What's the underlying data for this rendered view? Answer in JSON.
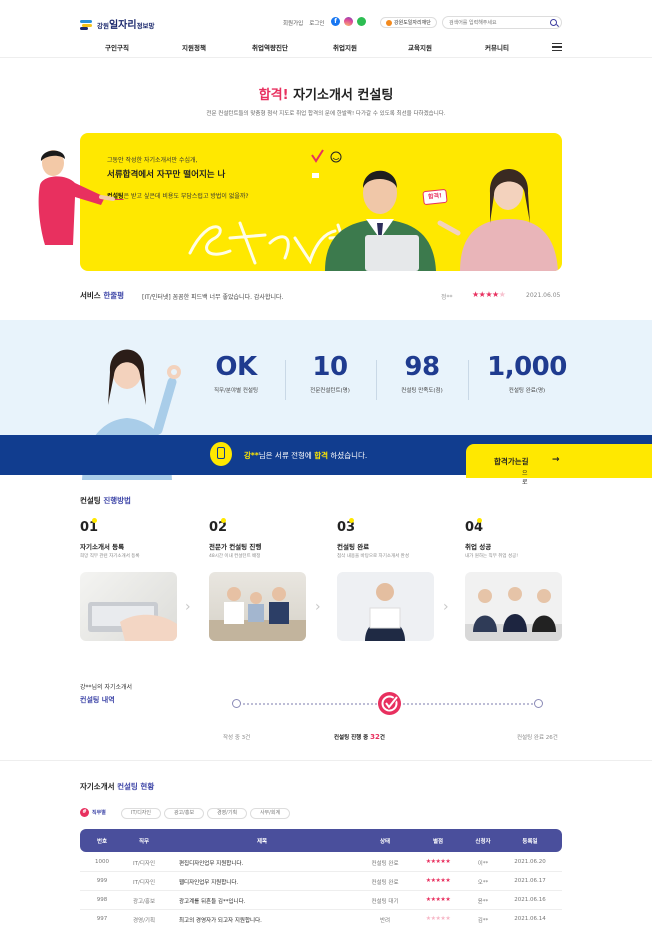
{
  "header": {
    "logo_prefix": "강원",
    "logo_main": "일자리",
    "logo_suffix": "정보망",
    "links": [
      "회원가입",
      "로그인"
    ],
    "gov_chip": "강원도일자리재단",
    "search_placeholder": "검색어를 입력해주세요"
  },
  "nav": [
    "구인구직",
    "지원정책",
    "취업역량진단",
    "취업지원",
    "교육지원",
    "커뮤니티"
  ],
  "hero": {
    "title_em": "합격!",
    "title_rest": " 자기소개서 컨설팅",
    "subtitle": "전문 컨설턴트들의 맞춤형 첨삭 지도로 취업 합격의 문에 한발짝! 다가갈 수 있도록 최선을 다하겠습니다."
  },
  "banner": {
    "line1": "그동안 작성한 자기소개서만 수십개,",
    "line2": "서류합격에서 자꾸만 떨어지는 나",
    "line3_em": "컨설팅",
    "line3_rest": "은 받고 싶은데 비용도 부담스럽고 방법이 없을까?",
    "script_word": "Start",
    "pass_tag": "합격!"
  },
  "review": {
    "label_a": "서비스 ",
    "label_b": "한줄평",
    "text": "[IT/인터넷] 꼼꼼한 피드백 너무 좋았습니다. 감사합니다.",
    "name": "정**",
    "rating": 4,
    "rating_max": 5,
    "stars_on": "★★★★",
    "stars_off": "★",
    "date": "2021.06.05"
  },
  "stats": [
    {
      "num": "OK",
      "label": "직무/분야별 컨설팅"
    },
    {
      "num": "10",
      "label": "전문컨설턴트(명)"
    },
    {
      "num": "98",
      "label": "컨설팅 만족도(점)"
    },
    {
      "num": "1,000",
      "label": "컨설팅 완료(명)"
    }
  ],
  "pass_band": {
    "name": "강**",
    "mid": "님은 서류 전형에 ",
    "em": "합격",
    "end": " 하셨습니다.",
    "button": "합격으로 가는길",
    "button_em": "합격",
    "button_rest": "으로 ",
    "button_end": "가는길",
    "arrow": "→"
  },
  "process": {
    "title_a": "컨설팅 ",
    "title_b": "진행방법",
    "steps": [
      {
        "n": "01",
        "title": "자기소개서 등록",
        "desc": "희망 직무 관련 자기소개서 등록"
      },
      {
        "n": "02",
        "title": "전문가 컨설팅 진행",
        "desc": "48시간 이내 컨설턴트 배정"
      },
      {
        "n": "03",
        "title": "컨설팅 완료",
        "desc": "첨삭 내용을 바탕으로 자기소개서 완성"
      },
      {
        "n": "04",
        "title": "취업 성공",
        "desc": "내가 원하는 직무 취업 성공!"
      }
    ]
  },
  "timeline": {
    "title1": "강**님의 자기소개서",
    "title2": "컨설팅 내역",
    "left_label": "작성 중 3건",
    "mid_label": "컨설팅 진행 중 ",
    "mid_count": "32",
    "mid_unit": "건",
    "right_label": "컨설팅 완료 26건"
  },
  "table": {
    "title_a": "자기소개서 ",
    "title_b": "컨설팅 현황",
    "filters": [
      "직무별",
      "IT/디자인",
      "광고/홍보",
      "경영/기획",
      "사무/회계"
    ],
    "headers": [
      "번호",
      "직무",
      "제목",
      "상태",
      "별점",
      "신청자",
      "등록일"
    ],
    "rows": [
      {
        "no": "1000",
        "job": "IT/디자인",
        "title": "편집디자인업무 지원합니다.",
        "status": "컨설팅 완료",
        "stars": "★★★★★",
        "user": "이**",
        "date": "2021.06.20"
      },
      {
        "no": "999",
        "job": "IT/디자인",
        "title": "웹디자인업무 지원합니다.",
        "status": "컨설팅 완료",
        "stars": "★★★★★",
        "user": "오**",
        "date": "2021.06.17"
      },
      {
        "no": "998",
        "job": "광고/홍보",
        "title": "광고계를 뒤흔들 김**입니다.",
        "status": "컨설팅 대기",
        "stars": "★★★★★",
        "user": "윤**",
        "date": "2021.06.16"
      },
      {
        "no": "997",
        "job": "경영/기획",
        "title": "최고의 경영자가 되고자 지원합니다.",
        "status": "반려",
        "stars": "★★★★★",
        "user": "김**",
        "date": "2021.06.14"
      }
    ]
  },
  "colors": {
    "accent": "#e8305f",
    "navy": "#113d8f",
    "yellow": "#ffe800",
    "indigo": "#4a4f9c"
  }
}
